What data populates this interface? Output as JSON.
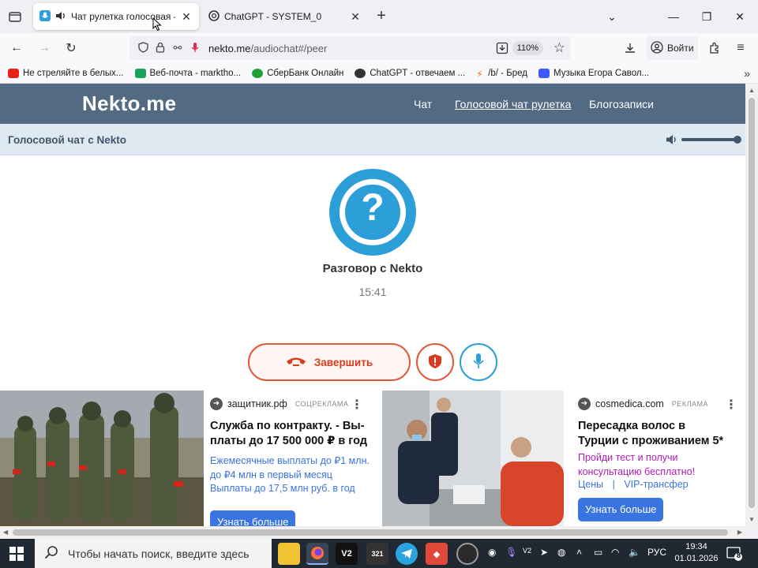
{
  "browser": {
    "tabs": [
      {
        "title": "Чат рулетка голосовая —",
        "active": true
      },
      {
        "title": "ChatGPT - SYSTEM_0",
        "active": false
      }
    ],
    "url_host": "nekto.me",
    "url_path": "/audiochat#/peer",
    "zoom": "110%",
    "signin_label": "Войти",
    "bookmarks": [
      {
        "label": "Не стреляйте в белых...",
        "color": "#e62117"
      },
      {
        "label": "Веб-почта - markthо...",
        "color": "#1aa35a"
      },
      {
        "label": "СберБанк Онлайн",
        "color": "#21a038"
      },
      {
        "label": "ChatGPT - отвечаем ...",
        "color": "#333333"
      },
      {
        "label": "/b/ - Бред",
        "color": "#ff6600"
      },
      {
        "label": "Музыка Егора Савол...",
        "color": "#3d5afe"
      }
    ]
  },
  "site": {
    "logo": "Nekto.me",
    "nav": [
      "Чат",
      "Голосовой чат рулетка",
      "Блогозаписи"
    ],
    "subbar_title": "Голосовой чат с Nekto",
    "volume_level": 1.0
  },
  "call": {
    "avatar_symbol": "?",
    "peer_name": "Разговор с Nekto",
    "timer": "15:41",
    "end_label": "Завершить"
  },
  "ads": [
    {
      "source": "защитник.рф",
      "tag": "СОЦРЕКЛАМА",
      "headline": "Служба по контракту. - Вы­платы до 17 500 000 ₽ в год",
      "text_lines": [
        "Ежемесячные выплаты до ₽1 млн.",
        "до ₽4 млн в первый месяц",
        "Выплаты до 17,5 млн руб. в год"
      ],
      "cta": "Узнать больше"
    },
    {
      "source": "cosmedica.com",
      "tag": "РЕКЛАМА",
      "headline": "Пересадка волос в Турции с проживанием 5*",
      "text": "Пройди тест и получи консультацию бесплатно!",
      "links": [
        "Цены",
        "|",
        "VIP-трансфер"
      ],
      "cta": "Узнать больше"
    }
  ],
  "taskbar": {
    "search_placeholder": "Чтобы начать поиск, введите здесь",
    "apps": [
      "V2",
      "321"
    ],
    "language": "РУС",
    "time": "19:34",
    "date": "01.01.2026",
    "notifications": "8"
  },
  "colors": {
    "header": "#526a82",
    "subbar": "#dfe9f2",
    "accent_blue": "#2c9fd9",
    "end_red": "#e0583a",
    "cta_blue": "#3a74e0"
  }
}
